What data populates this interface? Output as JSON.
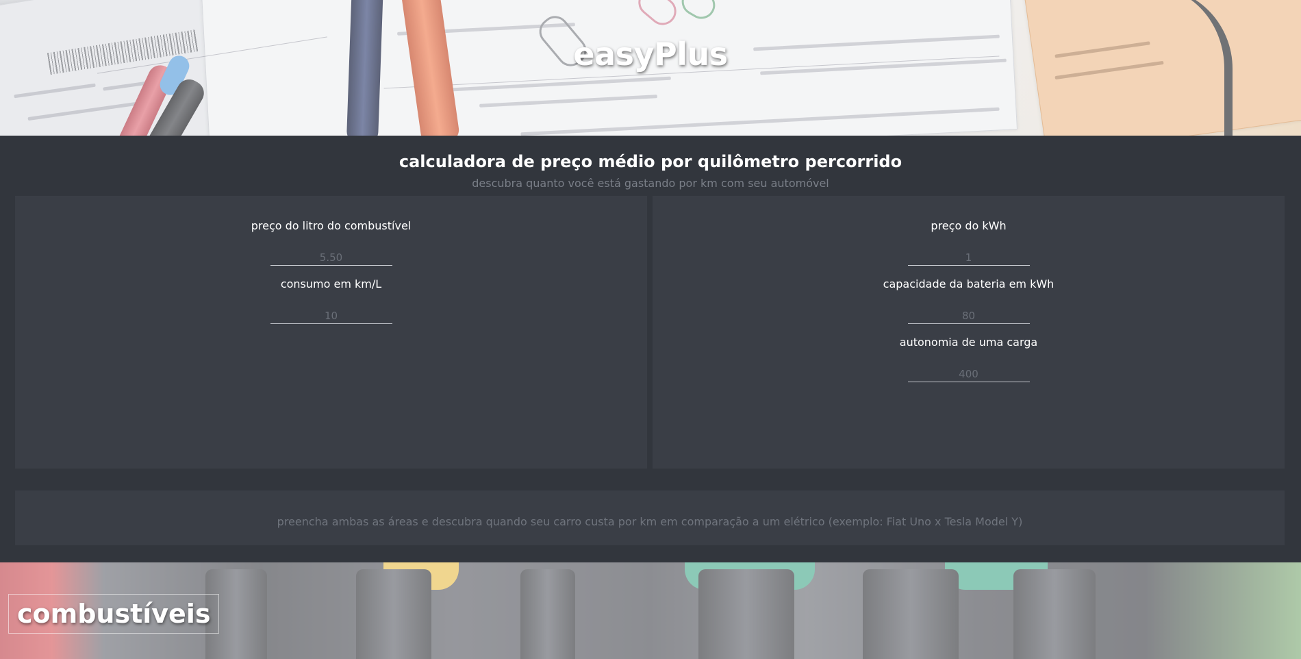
{
  "header": {
    "brand": "easyPlus"
  },
  "calculator": {
    "title": "calculadora de preço médio por quilômetro percorrido",
    "subtitle": "descubra quanto você está gastando por km com seu automóvel",
    "fuel_panel": {
      "fields": [
        {
          "label": "preço do litro do combustível",
          "placeholder": "5.50",
          "value": ""
        },
        {
          "label": "consumo em km/L",
          "placeholder": "10",
          "value": ""
        }
      ]
    },
    "electric_panel": {
      "fields": [
        {
          "label": "preço do kWh",
          "placeholder": "1",
          "value": ""
        },
        {
          "label": "capacidade da bateria em kWh",
          "placeholder": "80",
          "value": ""
        },
        {
          "label": "autonomia de uma carga",
          "placeholder": "400",
          "value": ""
        }
      ]
    },
    "result_text": "preencha ambas as áreas e descubra quando seu carro custa por km em comparação a um elétrico (exemplo: Fiat Uno x Tesla Model Y)"
  },
  "fuel_section": {
    "label": "combustíveis"
  },
  "colors": {
    "background": "#32363d",
    "panel": "#3a3e46",
    "muted_text": "#7a7f88",
    "text": "#ffffff"
  }
}
